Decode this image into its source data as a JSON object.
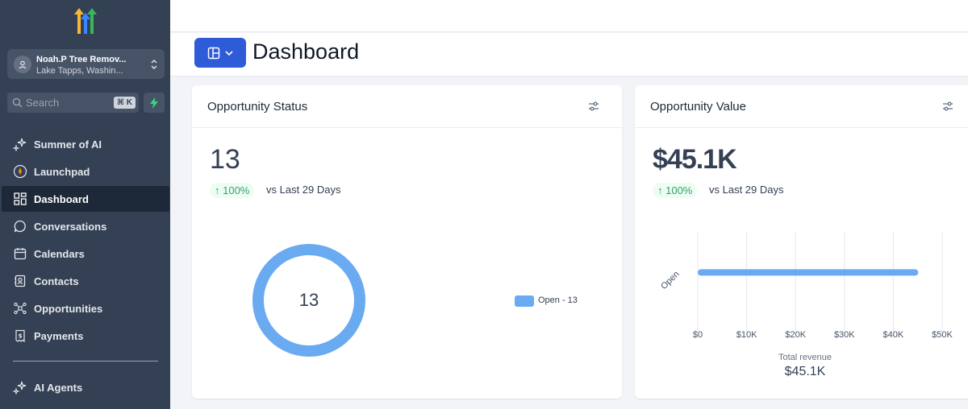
{
  "sidebar": {
    "account": {
      "name": "Noah.P Tree Remov...",
      "location": "Lake Tapps, Washin..."
    },
    "search": {
      "placeholder": "Search",
      "shortcut": "⌘ K"
    },
    "items": [
      {
        "label": "Summer of AI",
        "icon": "sparkles-icon"
      },
      {
        "label": "Launchpad",
        "icon": "rocket-icon"
      },
      {
        "label": "Dashboard",
        "icon": "grid-icon",
        "active": true
      },
      {
        "label": "Conversations",
        "icon": "chat-icon"
      },
      {
        "label": "Calendars",
        "icon": "calendar-icon"
      },
      {
        "label": "Contacts",
        "icon": "contact-book-icon"
      },
      {
        "label": "Opportunities",
        "icon": "network-icon"
      },
      {
        "label": "Payments",
        "icon": "invoice-icon"
      },
      {
        "label": "AI Agents",
        "icon": "sparkles-icon"
      }
    ]
  },
  "header": {
    "title": "Dashboard"
  },
  "opportunity_status": {
    "title": "Opportunity Status",
    "total": "13",
    "delta": "↑ 100%",
    "comparison": "vs Last 29 Days",
    "donut_center": "13",
    "legend": "Open - 13",
    "color": "#6aaaf1"
  },
  "opportunity_value": {
    "title": "Opportunity Value",
    "total": "$45.1K",
    "delta": "↑ 100%",
    "comparison": "vs Last 29 Days",
    "axis_label": "Total revenue",
    "total_label": "$45.1K"
  },
  "chart_data": {
    "type": "bar",
    "orientation": "horizontal",
    "categories": [
      "Open"
    ],
    "values": [
      45100
    ],
    "xlim": [
      0,
      50000
    ],
    "x_ticks": [
      "$0",
      "$10K",
      "$20K",
      "$30K",
      "$40K",
      "$50K"
    ],
    "xlabel": "Total revenue",
    "grid": true
  }
}
